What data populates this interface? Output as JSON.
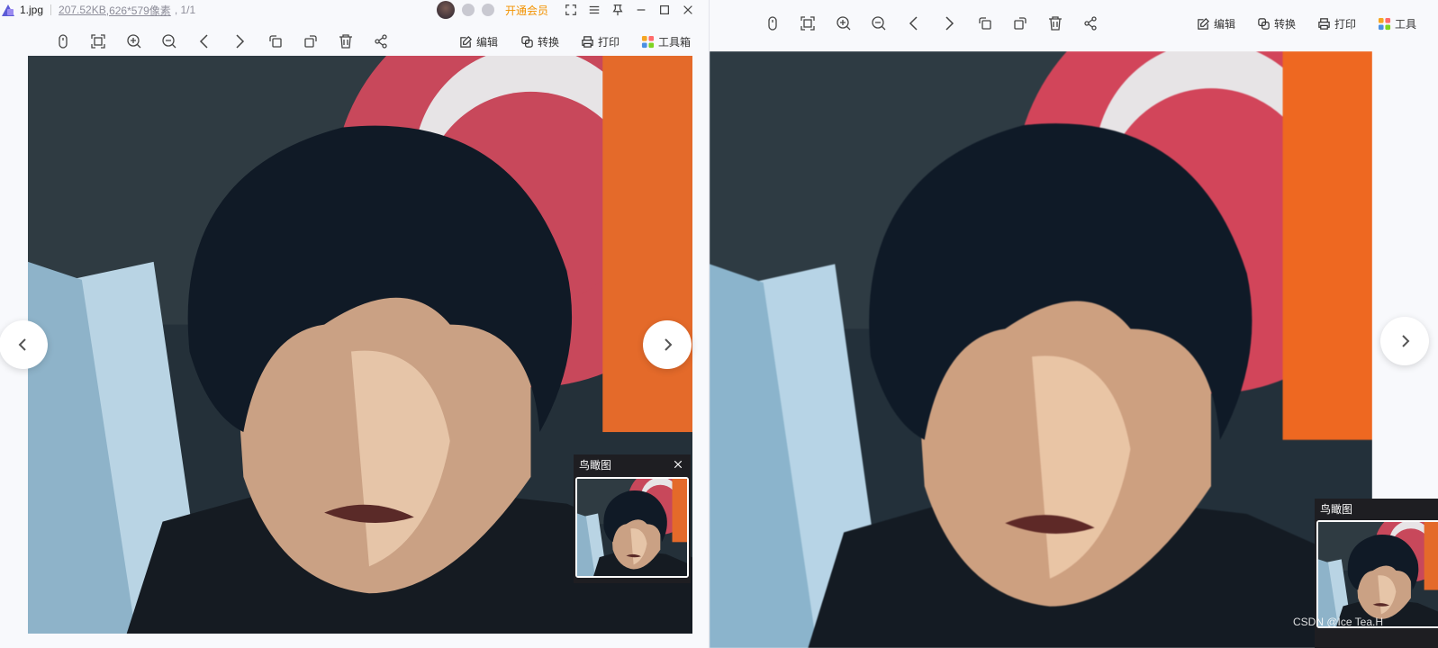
{
  "left_window": {
    "title": {
      "file_name": "1.jpg",
      "file_size": "207.52KB",
      "dimensions": ",626*579像素",
      "page_info": ", 1/1",
      "vip_label": "开通会员"
    },
    "toolbar": {
      "edit_label": "编辑",
      "convert_label": "转换",
      "print_label": "打印",
      "toolbox_label": "工具箱"
    },
    "birdview": {
      "title": "鸟瞰图"
    }
  },
  "right_window": {
    "toolbar": {
      "edit_label": "编辑",
      "convert_label": "转换",
      "print_label": "打印",
      "toolbox_label": "工具"
    },
    "birdview": {
      "title": "鸟瞰图"
    }
  },
  "watermark": "CSDN @Ice Tea.H",
  "icons": {
    "toolbar": [
      "mouse-icon",
      "fit-screen-icon",
      "zoom-in-icon",
      "zoom-out-icon",
      "previous-icon",
      "next-icon",
      "rotate-left-icon",
      "rotate-right-icon",
      "delete-icon",
      "share-icon"
    ],
    "window": [
      "fullscreen-icon",
      "menu-icon",
      "pin-icon",
      "minimize-icon",
      "maximize-icon",
      "close-icon"
    ]
  },
  "colors": {
    "accent_vip": "#f29200",
    "background": "#f8f9fc",
    "birdview_bg": "#1e1e22"
  }
}
